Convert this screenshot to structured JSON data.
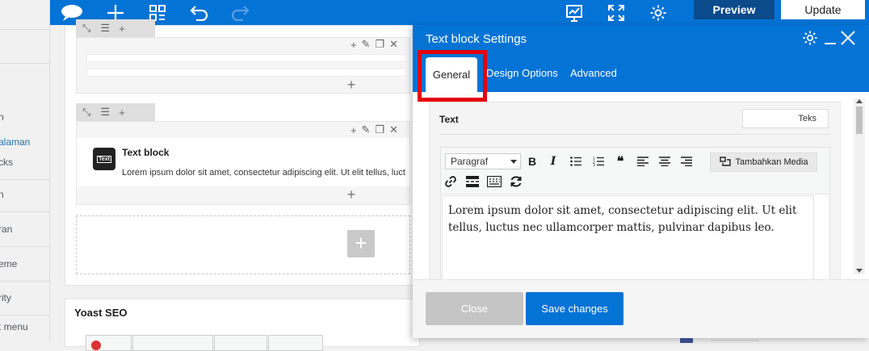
{
  "wp_sidebar": {
    "items": [
      {
        "label": "n",
        "active": false
      },
      {
        "label": "alaman",
        "active": true
      },
      {
        "label": "cks",
        "active": false
      },
      {
        "label": "n",
        "active": false
      },
      {
        "label": "ran",
        "active": false
      },
      {
        "label": "eme",
        "active": false
      },
      {
        "label": "rity",
        "active": false
      },
      {
        "label": "t menu",
        "active": false
      }
    ]
  },
  "toolbar": {
    "preview_label": "Preview",
    "update_label": "Update",
    "icons": [
      "chat-bubble-icon",
      "add-icon",
      "layout-icon",
      "undo-icon",
      "redo-icon",
      "seo-chart-icon",
      "fullscreen-icon",
      "settings-icon"
    ]
  },
  "canvas": {
    "text_block": {
      "title": "Text block",
      "icon_label": "Text",
      "excerpt": "Lorem ipsum dolor sit amet, consectetur adipiscing elit. Ut elit tellus, luct"
    }
  },
  "yoast": {
    "title": "Yoast SEO"
  },
  "panel": {
    "title": "Text block Settings",
    "tabs": [
      {
        "label": "General",
        "active": true
      },
      {
        "label": "Design Options",
        "active": false
      },
      {
        "label": "Advanced",
        "active": false
      }
    ],
    "field_label": "Text",
    "teks_button": "Teks",
    "format_select": "Paragraf",
    "add_media": "Tambahkan Media",
    "content": "Lorem ipsum dolor sit amet, consectetur adipiscing elit. Ut elit tellus, luctus nec ullamcorper mattis, pulvinar dapibus leo.",
    "close_label": "Close",
    "save_label": "Save changes"
  },
  "colors": {
    "toolbar_blue": "#0473d6",
    "preview_dark": "#0b4a8b",
    "highlight_red": "#e5000b"
  }
}
